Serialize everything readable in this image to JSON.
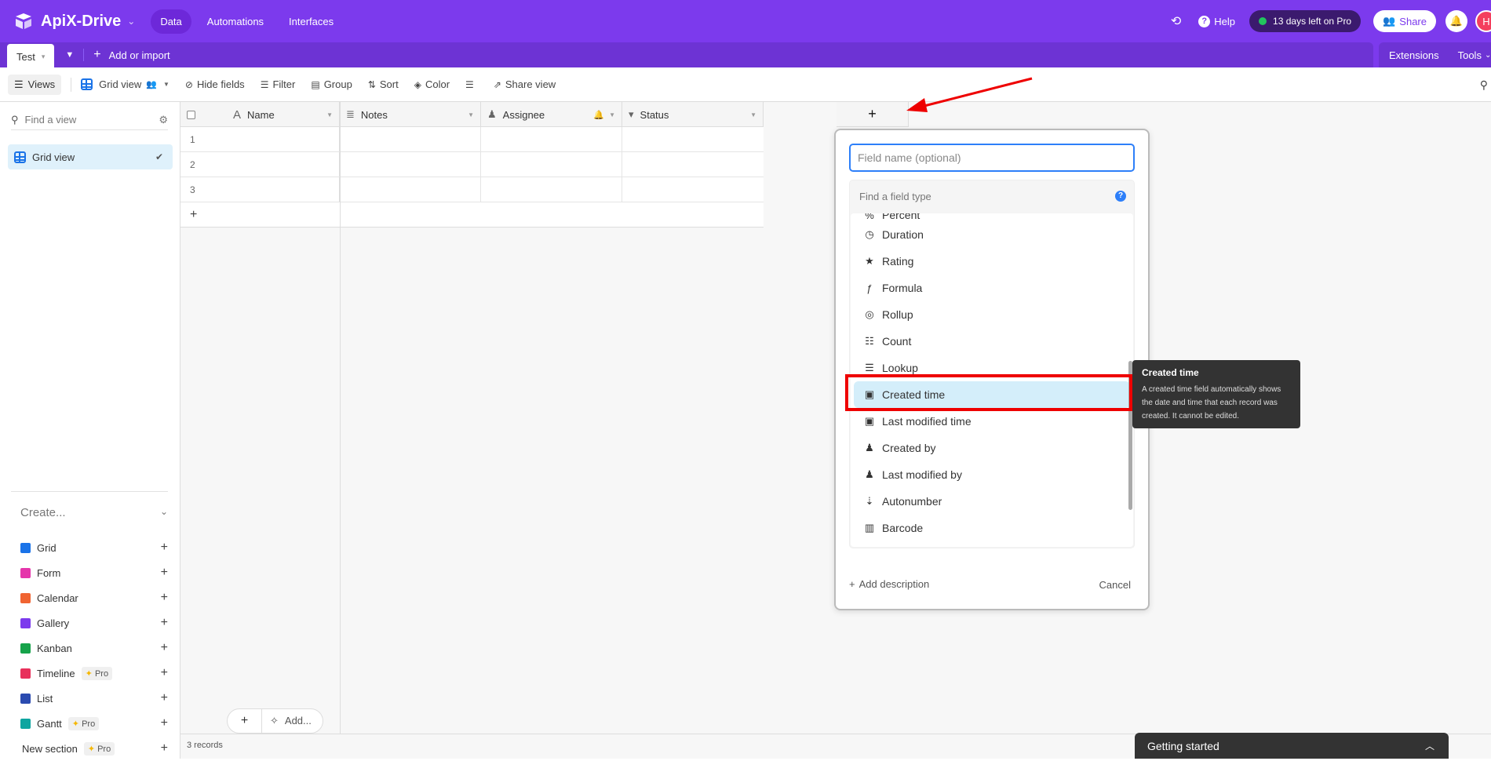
{
  "app": {
    "name": "ApiX-Drive",
    "nav_tabs": [
      "Data",
      "Automations",
      "Interfaces"
    ],
    "active_nav": "Data",
    "help_label": "Help",
    "trial_label": "13 days left on Pro",
    "share_label": "Share",
    "avatar_initial": "H"
  },
  "tabbar": {
    "table_tab": "Test",
    "add_import_label": "Add or import",
    "extensions_label": "Extensions",
    "tools_label": "Tools"
  },
  "toolbar": {
    "views_label": "Views",
    "view_name": "Grid view",
    "hide_fields": "Hide fields",
    "filter": "Filter",
    "group": "Group",
    "sort": "Sort",
    "color": "Color",
    "share_view": "Share view"
  },
  "sidebar": {
    "find_placeholder": "Find a view",
    "views": [
      {
        "label": "Grid view",
        "selected": true
      }
    ],
    "create_label": "Create...",
    "create_items": [
      {
        "label": "Grid",
        "color": "#1a73e8",
        "pro": false
      },
      {
        "label": "Form",
        "color": "#e535ab",
        "pro": false
      },
      {
        "label": "Calendar",
        "color": "#f06432",
        "pro": false
      },
      {
        "label": "Gallery",
        "color": "#7c3aed",
        "pro": false
      },
      {
        "label": "Kanban",
        "color": "#16a34a",
        "pro": false
      },
      {
        "label": "Timeline",
        "color": "#e8305b",
        "pro": true
      },
      {
        "label": "List",
        "color": "#2b4bb0",
        "pro": false
      },
      {
        "label": "Gantt",
        "color": "#0ea5a0",
        "pro": true
      }
    ],
    "new_section_label": "New section",
    "pro_label": "Pro"
  },
  "grid": {
    "columns": [
      {
        "label": "Name",
        "icon": "text-icon"
      },
      {
        "label": "Notes",
        "icon": "long-text-icon"
      },
      {
        "label": "Assignee",
        "icon": "user-icon"
      },
      {
        "label": "Status",
        "icon": "status-icon"
      }
    ],
    "rows": [
      "1",
      "2",
      "3"
    ],
    "add_row": "+",
    "add_column": "+",
    "records_label": "3 records",
    "add_label": "Add..."
  },
  "field_popup": {
    "name_placeholder": "Field name (optional)",
    "type_search_placeholder": "Find a field type",
    "field_types": [
      {
        "label": "Percent",
        "icon": "%"
      },
      {
        "label": "Duration",
        "icon": "◷"
      },
      {
        "label": "Rating",
        "icon": "★"
      },
      {
        "label": "Formula",
        "icon": "ƒ"
      },
      {
        "label": "Rollup",
        "icon": "◎"
      },
      {
        "label": "Count",
        "icon": "☷"
      },
      {
        "label": "Lookup",
        "icon": "☰"
      },
      {
        "label": "Created time",
        "icon": "▣",
        "highlighted": true
      },
      {
        "label": "Last modified time",
        "icon": "▣"
      },
      {
        "label": "Created by",
        "icon": "♟"
      },
      {
        "label": "Last modified by",
        "icon": "♟"
      },
      {
        "label": "Autonumber",
        "icon": "⇣"
      },
      {
        "label": "Barcode",
        "icon": "▥"
      }
    ],
    "add_description": "Add description",
    "cancel": "Cancel"
  },
  "tooltip": {
    "title": "Created time",
    "description": "A created time field automatically shows the date and time that each record was created. It cannot be edited."
  },
  "getting_started": {
    "label": "Getting started"
  }
}
